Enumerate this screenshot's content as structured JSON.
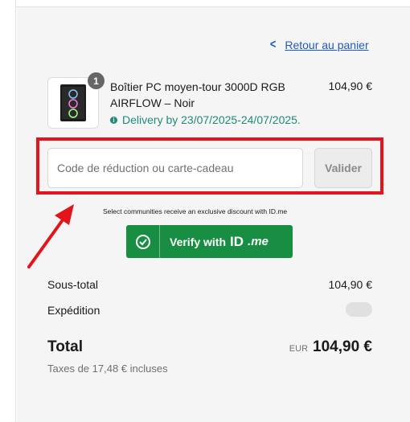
{
  "back_link": {
    "label": "Retour au panier"
  },
  "product": {
    "quantity": "1",
    "name": "Boîtier PC moyen-tour 3000D RGB AIRFLOW – Noir",
    "delivery": "Delivery by 23/07/2025-24/07/2025.",
    "price": "104,90 €"
  },
  "discount": {
    "placeholder": "Code de réduction ou carte-cadeau",
    "button_label": "Valider"
  },
  "idme": {
    "note": "Select communities receive an exclusive discount with ID.me",
    "button_label": "Verify with",
    "brand_id": "ID",
    "brand_me": ".me"
  },
  "summary": {
    "subtotal_label": "Sous-total",
    "subtotal_value": "104,90 €",
    "shipping_label": "Expédition",
    "total_label": "Total",
    "currency": "EUR",
    "total_value": "104,90 €",
    "tax_note": "Taxes de 17,48 € incluses"
  },
  "colors": {
    "link": "#1e5bbf",
    "delivery": "#1f8a7a",
    "highlight": "#e3141b",
    "idme_green": "#178e42"
  }
}
